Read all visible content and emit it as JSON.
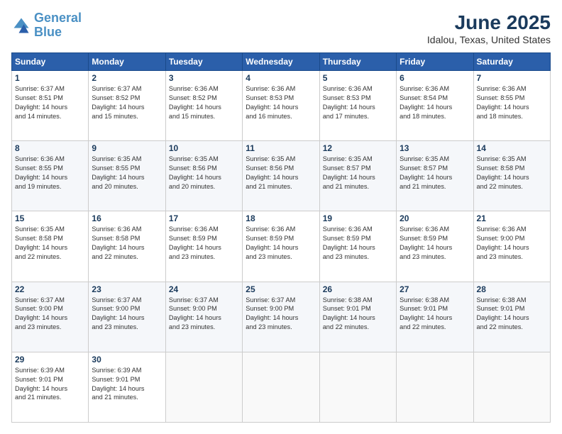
{
  "header": {
    "logo_line1": "General",
    "logo_line2": "Blue",
    "month": "June 2025",
    "location": "Idalou, Texas, United States"
  },
  "weekdays": [
    "Sunday",
    "Monday",
    "Tuesday",
    "Wednesday",
    "Thursday",
    "Friday",
    "Saturday"
  ],
  "weeks": [
    [
      {
        "day": "1",
        "info": "Sunrise: 6:37 AM\nSunset: 8:51 PM\nDaylight: 14 hours\nand 14 minutes."
      },
      {
        "day": "2",
        "info": "Sunrise: 6:37 AM\nSunset: 8:52 PM\nDaylight: 14 hours\nand 15 minutes."
      },
      {
        "day": "3",
        "info": "Sunrise: 6:36 AM\nSunset: 8:52 PM\nDaylight: 14 hours\nand 15 minutes."
      },
      {
        "day": "4",
        "info": "Sunrise: 6:36 AM\nSunset: 8:53 PM\nDaylight: 14 hours\nand 16 minutes."
      },
      {
        "day": "5",
        "info": "Sunrise: 6:36 AM\nSunset: 8:53 PM\nDaylight: 14 hours\nand 17 minutes."
      },
      {
        "day": "6",
        "info": "Sunrise: 6:36 AM\nSunset: 8:54 PM\nDaylight: 14 hours\nand 18 minutes."
      },
      {
        "day": "7",
        "info": "Sunrise: 6:36 AM\nSunset: 8:55 PM\nDaylight: 14 hours\nand 18 minutes."
      }
    ],
    [
      {
        "day": "8",
        "info": "Sunrise: 6:36 AM\nSunset: 8:55 PM\nDaylight: 14 hours\nand 19 minutes."
      },
      {
        "day": "9",
        "info": "Sunrise: 6:35 AM\nSunset: 8:55 PM\nDaylight: 14 hours\nand 20 minutes."
      },
      {
        "day": "10",
        "info": "Sunrise: 6:35 AM\nSunset: 8:56 PM\nDaylight: 14 hours\nand 20 minutes."
      },
      {
        "day": "11",
        "info": "Sunrise: 6:35 AM\nSunset: 8:56 PM\nDaylight: 14 hours\nand 21 minutes."
      },
      {
        "day": "12",
        "info": "Sunrise: 6:35 AM\nSunset: 8:57 PM\nDaylight: 14 hours\nand 21 minutes."
      },
      {
        "day": "13",
        "info": "Sunrise: 6:35 AM\nSunset: 8:57 PM\nDaylight: 14 hours\nand 21 minutes."
      },
      {
        "day": "14",
        "info": "Sunrise: 6:35 AM\nSunset: 8:58 PM\nDaylight: 14 hours\nand 22 minutes."
      }
    ],
    [
      {
        "day": "15",
        "info": "Sunrise: 6:35 AM\nSunset: 8:58 PM\nDaylight: 14 hours\nand 22 minutes."
      },
      {
        "day": "16",
        "info": "Sunrise: 6:36 AM\nSunset: 8:58 PM\nDaylight: 14 hours\nand 22 minutes."
      },
      {
        "day": "17",
        "info": "Sunrise: 6:36 AM\nSunset: 8:59 PM\nDaylight: 14 hours\nand 23 minutes."
      },
      {
        "day": "18",
        "info": "Sunrise: 6:36 AM\nSunset: 8:59 PM\nDaylight: 14 hours\nand 23 minutes."
      },
      {
        "day": "19",
        "info": "Sunrise: 6:36 AM\nSunset: 8:59 PM\nDaylight: 14 hours\nand 23 minutes."
      },
      {
        "day": "20",
        "info": "Sunrise: 6:36 AM\nSunset: 8:59 PM\nDaylight: 14 hours\nand 23 minutes."
      },
      {
        "day": "21",
        "info": "Sunrise: 6:36 AM\nSunset: 9:00 PM\nDaylight: 14 hours\nand 23 minutes."
      }
    ],
    [
      {
        "day": "22",
        "info": "Sunrise: 6:37 AM\nSunset: 9:00 PM\nDaylight: 14 hours\nand 23 minutes."
      },
      {
        "day": "23",
        "info": "Sunrise: 6:37 AM\nSunset: 9:00 PM\nDaylight: 14 hours\nand 23 minutes."
      },
      {
        "day": "24",
        "info": "Sunrise: 6:37 AM\nSunset: 9:00 PM\nDaylight: 14 hours\nand 23 minutes."
      },
      {
        "day": "25",
        "info": "Sunrise: 6:37 AM\nSunset: 9:00 PM\nDaylight: 14 hours\nand 23 minutes."
      },
      {
        "day": "26",
        "info": "Sunrise: 6:38 AM\nSunset: 9:01 PM\nDaylight: 14 hours\nand 22 minutes."
      },
      {
        "day": "27",
        "info": "Sunrise: 6:38 AM\nSunset: 9:01 PM\nDaylight: 14 hours\nand 22 minutes."
      },
      {
        "day": "28",
        "info": "Sunrise: 6:38 AM\nSunset: 9:01 PM\nDaylight: 14 hours\nand 22 minutes."
      }
    ],
    [
      {
        "day": "29",
        "info": "Sunrise: 6:39 AM\nSunset: 9:01 PM\nDaylight: 14 hours\nand 21 minutes."
      },
      {
        "day": "30",
        "info": "Sunrise: 6:39 AM\nSunset: 9:01 PM\nDaylight: 14 hours\nand 21 minutes."
      },
      {
        "day": "",
        "info": ""
      },
      {
        "day": "",
        "info": ""
      },
      {
        "day": "",
        "info": ""
      },
      {
        "day": "",
        "info": ""
      },
      {
        "day": "",
        "info": ""
      }
    ]
  ]
}
